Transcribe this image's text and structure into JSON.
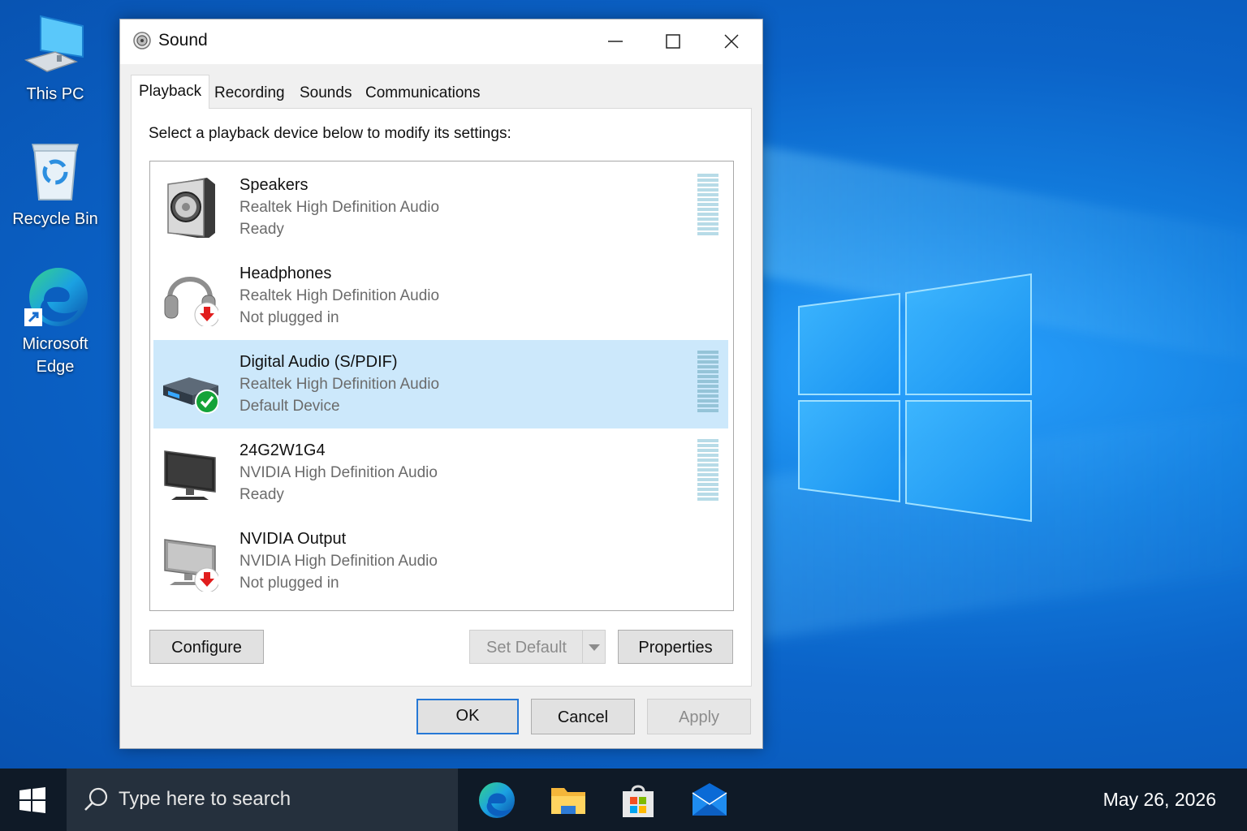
{
  "desktop": {
    "icons": [
      {
        "label": "This PC"
      },
      {
        "label": "Recycle Bin"
      },
      {
        "label_line1": "Microsoft",
        "label_line2": "Edge"
      }
    ]
  },
  "dialog": {
    "title": "Sound",
    "tabs": [
      {
        "label": "Playback",
        "active": true
      },
      {
        "label": "Recording"
      },
      {
        "label": "Sounds"
      },
      {
        "label": "Communications"
      }
    ],
    "instruction": "Select a playback device below to modify its settings:",
    "devices": [
      {
        "name": "Speakers",
        "driver": "Realtek High Definition Audio",
        "status": "Ready",
        "icon": "speaker-icon"
      },
      {
        "name": "Headphones",
        "driver": "Realtek High Definition Audio",
        "status": "Not plugged in",
        "icon": "headphones-icon"
      },
      {
        "name": "Digital Audio (S/PDIF)",
        "driver": "Realtek High Definition Audio",
        "status": "Default Device",
        "icon": "digital-audio-icon",
        "selected": true
      },
      {
        "name": "24G2W1G4",
        "driver": "NVIDIA High Definition Audio",
        "status": "Ready",
        "icon": "monitor-icon"
      },
      {
        "name": "NVIDIA Output",
        "driver": "NVIDIA High Definition Audio",
        "status": "Not plugged in",
        "icon": "monitor-disconnected-icon"
      }
    ],
    "buttons": {
      "configure": "Configure",
      "set_default": "Set Default",
      "properties": "Properties",
      "ok": "OK",
      "cancel": "Cancel",
      "apply": "Apply"
    }
  },
  "taskbar": {
    "search_placeholder": "Type here to search",
    "date": "May 26, 2026"
  },
  "colors": {
    "selection": "#cce8fb",
    "accent": "#2678d6",
    "taskbar": "#0f1a27"
  }
}
